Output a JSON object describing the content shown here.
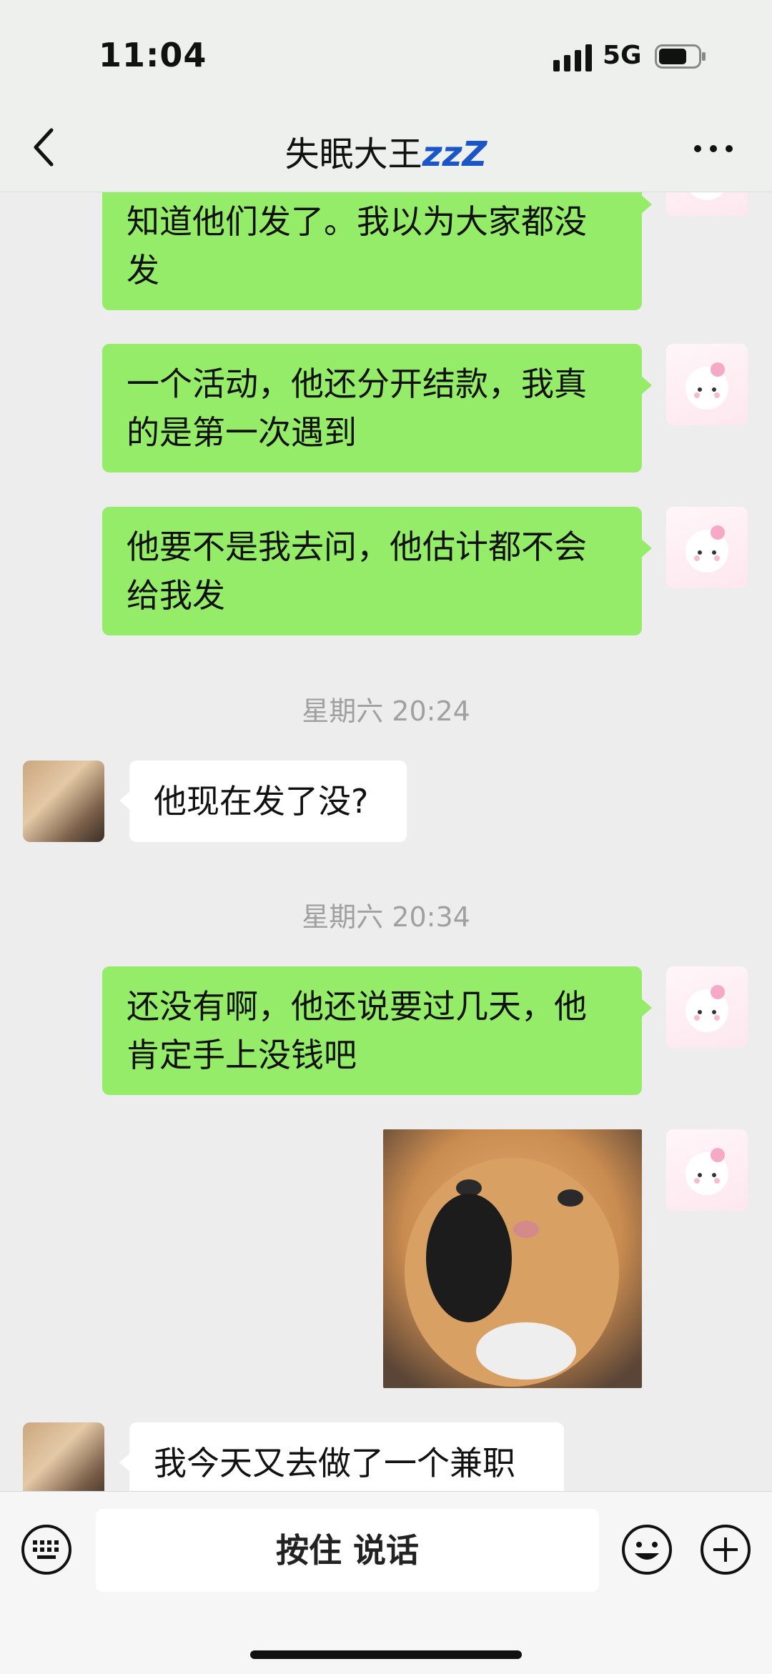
{
  "status_bar": {
    "time": "11:04",
    "network": "5G"
  },
  "header": {
    "title": "失眠大王",
    "title_badge": "zzZ"
  },
  "messages": [
    {
      "line1": "知道他们发了。我以为大家都没",
      "line2": "发"
    },
    {
      "line1": "一个活动，他还分开结款，我真",
      "line2": "的是第一次遇到"
    },
    {
      "line1": "他要不是我去问，他估计都不会",
      "line2": "给我发"
    },
    {
      "timestamp": "星期六 20:24"
    },
    {
      "text": "他现在发了没?"
    },
    {
      "timestamp": "星期六 20:34"
    },
    {
      "line1": "还没有啊，他还说要过几天，他",
      "line2": "肯定手上没钱吧"
    },
    {
      "image": "cat-photo"
    },
    {
      "text": "我今天又去做了一个兼职"
    }
  ],
  "input_bar": {
    "voice_label": "按住 说话"
  },
  "colors": {
    "outgoing_bubble": "#95ec69",
    "incoming_bubble": "#ffffff",
    "background": "#ededed"
  }
}
